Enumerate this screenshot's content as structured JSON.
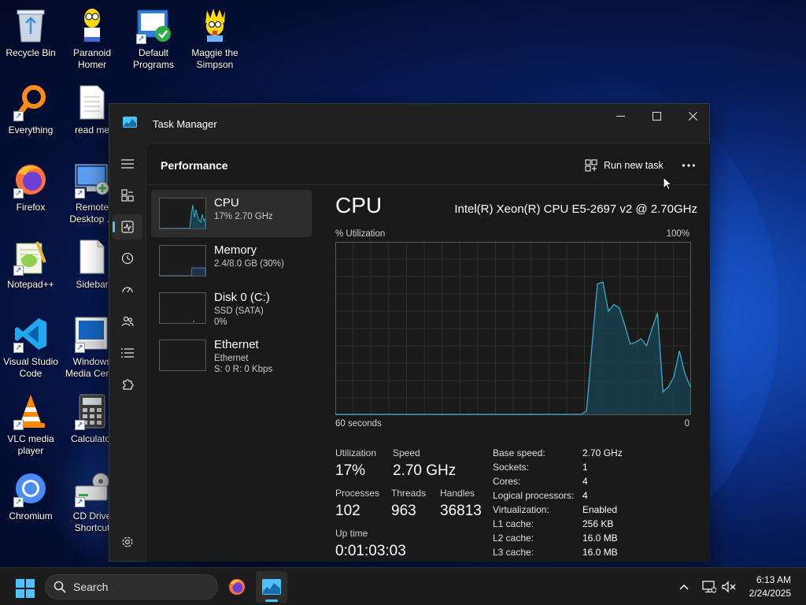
{
  "desktop": {
    "icons": [
      {
        "name": "recycle-bin",
        "label1": "Recycle Bin",
        "label2": ""
      },
      {
        "name": "paranoid-homer",
        "label1": "Paranoid",
        "label2": "Homer"
      },
      {
        "name": "default-programs",
        "label1": "Default",
        "label2": "Programs"
      },
      {
        "name": "maggie-simpson",
        "label1": "Maggie the",
        "label2": "Simpson"
      },
      {
        "name": "everything",
        "label1": "Everything",
        "label2": ""
      },
      {
        "name": "read-me",
        "label1": "read me",
        "label2": ""
      },
      {
        "name": "firefox",
        "label1": "Firefox",
        "label2": ""
      },
      {
        "name": "remote-desktop",
        "label1": "Remote",
        "label2": "Desktop ..."
      },
      {
        "name": "notepad-plus-plus",
        "label1": "Notepad++",
        "label2": ""
      },
      {
        "name": "sidebar",
        "label1": "Sidebar",
        "label2": ""
      },
      {
        "name": "vscode",
        "label1": "Visual Studio",
        "label2": "Code"
      },
      {
        "name": "windows-media-center",
        "label1": "Windows",
        "label2": "Media Cen..."
      },
      {
        "name": "vlc",
        "label1": "VLC media",
        "label2": "player"
      },
      {
        "name": "calculator",
        "label1": "Calculator",
        "label2": ""
      },
      {
        "name": "chromium",
        "label1": "Chromium",
        "label2": ""
      },
      {
        "name": "cd-drive",
        "label1": "CD Drive",
        "label2": "Shortcut"
      }
    ]
  },
  "taskmanager": {
    "title": "Task Manager",
    "page_title": "Performance",
    "run_new_task": "Run new task",
    "more": "···",
    "resources": [
      {
        "name": "CPU",
        "sub1": "17%  2.70 GHz",
        "sub2": ""
      },
      {
        "name": "Memory",
        "sub1": "2.4/8.0 GB (30%)",
        "sub2": ""
      },
      {
        "name": "Disk 0 (C:)",
        "sub1": "SSD (SATA)",
        "sub2": "0%"
      },
      {
        "name": "Ethernet",
        "sub1": "Ethernet",
        "sub2": "S: 0  R: 0 Kbps"
      }
    ],
    "cpu": {
      "heading": "CPU",
      "model": "Intel(R) Xeon(R) CPU E5-2697 v2 @ 2.70GHz",
      "util_label": "% Utilization",
      "util_max": "100%",
      "x_left": "60 seconds",
      "x_right": "0",
      "stats": {
        "utilization_label": "Utilization",
        "utilization": "17%",
        "speed_label": "Speed",
        "speed": "2.70 GHz",
        "processes_label": "Processes",
        "processes": "102",
        "threads_label": "Threads",
        "threads": "963",
        "handles_label": "Handles",
        "handles": "36813",
        "uptime_label": "Up time",
        "uptime": "0:01:03:03"
      },
      "specs": [
        {
          "label": "Base speed:",
          "value": "2.70 GHz"
        },
        {
          "label": "Sockets:",
          "value": "1"
        },
        {
          "label": "Cores:",
          "value": "4"
        },
        {
          "label": "Logical processors:",
          "value": "4"
        },
        {
          "label": "Virtualization:",
          "value": "Enabled"
        },
        {
          "label": "L1 cache:",
          "value": "256 KB"
        },
        {
          "label": "L2 cache:",
          "value": "16.0 MB"
        },
        {
          "label": "L3 cache:",
          "value": "16.0 MB"
        }
      ],
      "graph_series": [
        0,
        0,
        0,
        0,
        0,
        0,
        0,
        0,
        0,
        0,
        0,
        0,
        0,
        0,
        0,
        0,
        0,
        0,
        0,
        0,
        0,
        0,
        0,
        0,
        0,
        0,
        0,
        0,
        0,
        0,
        0,
        0,
        0,
        0,
        0,
        0,
        0,
        0,
        0,
        0,
        0,
        0,
        0,
        0,
        0,
        0,
        2,
        40,
        76,
        77,
        60,
        64,
        62,
        52,
        41,
        42,
        44,
        40,
        50,
        59,
        13,
        16,
        22,
        37,
        24,
        16
      ]
    }
  },
  "taskbar": {
    "search_placeholder": "Search",
    "time": "6:13 AM",
    "date": "2/24/2025"
  },
  "colors": {
    "accent": "#4cc2ff",
    "graph_line": "#3fa9c9",
    "graph_fill": "#17414f"
  }
}
